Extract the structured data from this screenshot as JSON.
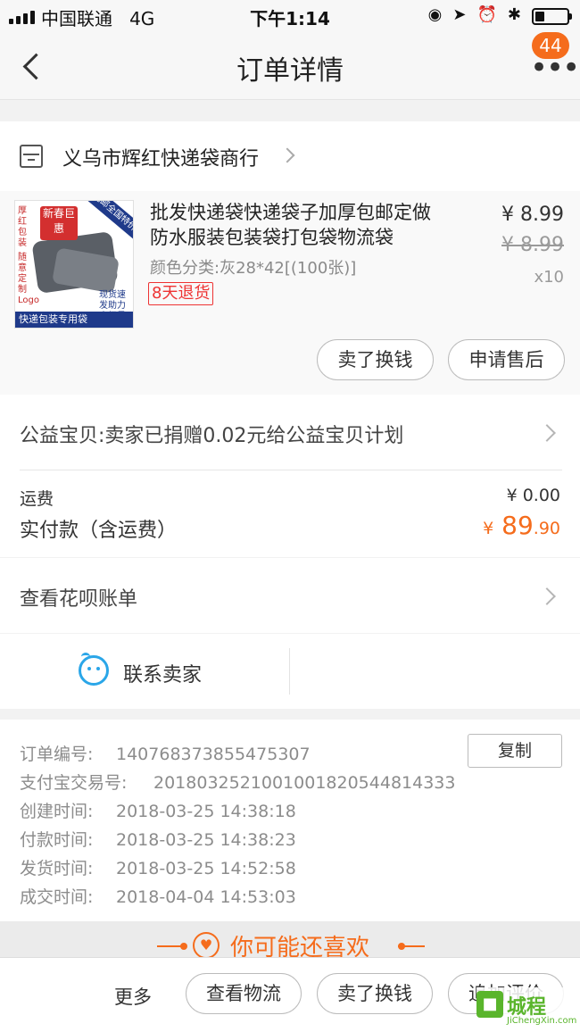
{
  "status_bar": {
    "carrier": "中国联通",
    "network": "4G",
    "time": "下午1:14",
    "battery_level": 0.3
  },
  "nav": {
    "title": "订单详情",
    "badge_count": "44"
  },
  "shop": {
    "name": "义乌市辉红快递袋商行"
  },
  "product": {
    "title": "批发快递袋快递袋子加厚包邮定做防水服装包装袋打包袋物流袋",
    "spec": "颜色分类:灰28*42[(100张)]",
    "return_policy": "8天退货",
    "price": "¥ 8.99",
    "original_price": "¥ 8.99",
    "quantity": "x10",
    "image_text": {
      "stamp": "新春巨惠",
      "side": "厚红包装",
      "side2": "随意定制Logo",
      "corner": "包邮全国特价",
      "promo": "现货速发助力大促量大优惠",
      "band": "快递包装专用袋"
    }
  },
  "actions": {
    "sell_exchange": "卖了换钱",
    "after_sale": "申请售后"
  },
  "charity": {
    "text": "公益宝贝:卖家已捐赠0.02元给公益宝贝计划"
  },
  "costs": {
    "shipping_label": "运费",
    "shipping_value": "¥ 0.00",
    "paid_label": "实付款（含运费）",
    "paid_currency": "¥",
    "paid_integer": "89",
    "paid_decimal": ".90"
  },
  "huabei": {
    "text": "查看花呗账单"
  },
  "contact": {
    "text": "联系卖家"
  },
  "order_info": {
    "copy_label": "复制",
    "rows": [
      {
        "label": "订单编号:",
        "value": "140768373855475307"
      },
      {
        "label": "支付宝交易号:",
        "value": "2018032521001001820544814333"
      },
      {
        "label": "创建时间:",
        "value": "2018-03-25 14:38:18"
      },
      {
        "label": "付款时间:",
        "value": "2018-03-25 14:38:23"
      },
      {
        "label": "发货时间:",
        "value": "2018-03-25 14:52:58"
      },
      {
        "label": "成交时间:",
        "value": "2018-04-04 14:53:03"
      }
    ]
  },
  "recommend": {
    "title": "你可能还喜欢"
  },
  "bottom_bar": {
    "more": "更多",
    "logistics": "查看物流",
    "sell_exchange": "卖了换钱",
    "add_review": "追加评价"
  },
  "watermark": {
    "cn": "城程",
    "en": "JiChengXin.com"
  },
  "colors": {
    "accent": "#f56c1c",
    "contact_blue": "#2aa6e8",
    "return_red": "#ee3333"
  },
  "icons": [
    "back-icon",
    "more-icon",
    "shop-icon",
    "chevron-right-icon",
    "contact-seller-icon",
    "heart-icon"
  ]
}
